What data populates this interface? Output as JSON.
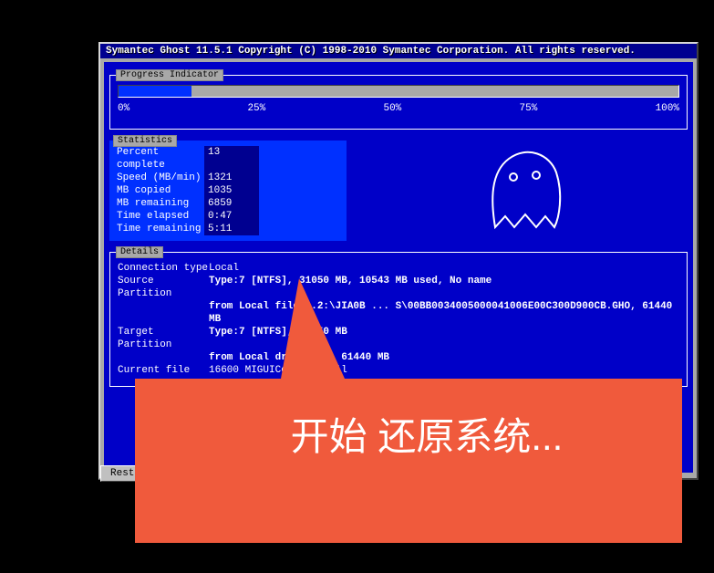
{
  "titlebar": "Symantec Ghost 11.5.1   Copyright (C) 1998-2010 Symantec Corporation. All rights reserved.",
  "progress": {
    "label": "Progress Indicator",
    "percent": 13,
    "ticks": [
      "0%",
      "25%",
      "50%",
      "75%",
      "100%"
    ]
  },
  "statistics": {
    "label": "Statistics",
    "items": [
      {
        "key": "Percent complete",
        "val": "13"
      },
      {
        "key": "Speed (MB/min)",
        "val": "1321"
      },
      {
        "key": "MB copied",
        "val": "1035"
      },
      {
        "key": "MB remaining",
        "val": "6859"
      },
      {
        "key": "Time elapsed",
        "val": "0:47"
      },
      {
        "key": "Time remaining",
        "val": "5:11"
      }
    ]
  },
  "details": {
    "label": "Details",
    "connection_type_key": "Connection type",
    "connection_type_val": "Local",
    "source_partition_key": "Source Partition",
    "source_partition_val": "Type:7 [NTFS], 31050 MB, 10543 MB used, No name",
    "source_partition_sub": "from Local file 1.2:\\JIA0B ... S\\00BB0034005000041006E00C300D900CB.GHO, 61440 MB",
    "target_partition_key": "Target Partition",
    "target_partition_val": "Type:7 [NTFS], 32050 MB",
    "target_partition_sub": "from Local drive [1], 61440 MB",
    "current_file_key": "Current file",
    "current_file_val": "16600 MIGUIControls.dll"
  },
  "buttons": {
    "restore": "Restore"
  },
  "callout": "开始 还原系统..."
}
